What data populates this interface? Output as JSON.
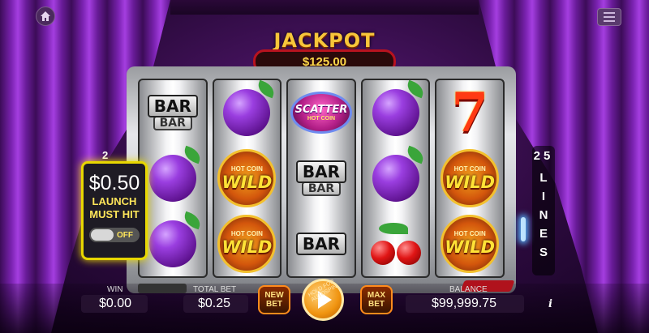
{
  "jackpot": {
    "title": "JACKPOT",
    "amount": "$125.00"
  },
  "reels": [
    [
      "BAR|BAR",
      "plum",
      "plum"
    ],
    [
      "plum",
      "wild",
      "wild"
    ],
    [
      "scatter",
      "BAR|BAR",
      "BAR"
    ],
    [
      "plum",
      "plum",
      "cherry"
    ],
    [
      "seven",
      "wild",
      "wild"
    ]
  ],
  "symbols": {
    "bar": "BAR",
    "wild_brand": "HOT COIN",
    "wild_text": "WILD",
    "scatter_text": "SCATTER",
    "scatter_brand": "HOT COIN",
    "seven": "7"
  },
  "lines": {
    "left_num": "2",
    "right_num": "25",
    "right_word": [
      "L",
      "I",
      "N",
      "E",
      "S"
    ]
  },
  "launch": {
    "amount": "$0.50",
    "line1": "LAUNCH",
    "line2": "MUST HIT",
    "toggle_state": "OFF"
  },
  "bottom": {
    "win_label": "WIN",
    "win_value": "$0.00",
    "total_bet_label": "TOTAL BET",
    "total_bet_value": "$0.25",
    "new_bet_line1": "NEW",
    "new_bet_line2": "BET",
    "autospin_text": "HOLD FOR AUTOSPIN",
    "max_bet_line1": "MAX",
    "max_bet_line2": "BET",
    "balance_label": "BALANCE",
    "balance_value": "$99,999.75",
    "info": "i"
  },
  "colors": {
    "accent": "#f7c63a",
    "launch_border": "#e8d700",
    "jackpot_border": "#b8131f"
  }
}
